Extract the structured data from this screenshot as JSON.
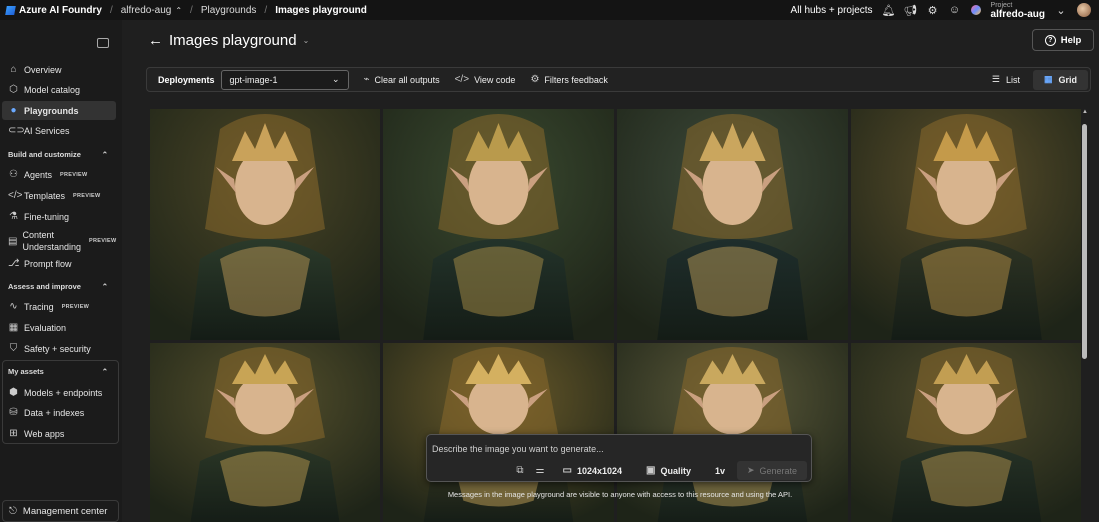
{
  "header": {
    "app_name": "Azure AI Foundry",
    "breadcrumb": [
      "alfredo-aug",
      "Playgrounds",
      "Images playground"
    ],
    "hubs_link": "All hubs + projects",
    "project_label": "Project",
    "project_name": "alfredo-aug"
  },
  "sidebar": {
    "items": [
      {
        "label": "Overview",
        "icon": "home-icon"
      },
      {
        "label": "Model catalog",
        "icon": "cube-icon"
      },
      {
        "label": "Playgrounds",
        "icon": "playground-icon",
        "active": true
      },
      {
        "label": "AI Services",
        "icon": "link-icon"
      }
    ],
    "section_build": "Build and customize",
    "build_items": [
      {
        "label": "Agents",
        "badge": "PREVIEW",
        "icon": "agent-icon"
      },
      {
        "label": "Templates",
        "badge": "PREVIEW",
        "icon": "code-icon"
      },
      {
        "label": "Fine-tuning",
        "icon": "flask-icon"
      },
      {
        "label": "Content Understanding",
        "badge": "PREVIEW",
        "icon": "scan-icon"
      },
      {
        "label": "Prompt flow",
        "icon": "flow-icon"
      }
    ],
    "section_assess": "Assess and improve",
    "assess_items": [
      {
        "label": "Tracing",
        "badge": "PREVIEW",
        "icon": "trace-icon"
      },
      {
        "label": "Evaluation",
        "icon": "evaluation-icon"
      },
      {
        "label": "Safety + security",
        "icon": "shield-icon"
      }
    ],
    "section_assets": "My assets",
    "asset_items": [
      {
        "label": "Models + endpoints",
        "icon": "models-icon"
      },
      {
        "label": "Data + indexes",
        "icon": "database-icon"
      },
      {
        "label": "Web apps",
        "icon": "webapp-icon"
      }
    ],
    "management": "Management center"
  },
  "page": {
    "title": "Images playground",
    "help_label": "Help"
  },
  "toolbar": {
    "deployments_label": "Deployments",
    "deployment_value": "gpt-image-1",
    "clear_label": "Clear all outputs",
    "view_code_label": "View code",
    "filters_label": "Filters feedback",
    "list_label": "List",
    "grid_label": "Grid",
    "active_view": "Grid"
  },
  "gallery": {
    "tile_count": 8
  },
  "prompt": {
    "placeholder": "Describe the image you want to generate...",
    "size": "1024x1024",
    "quality_label": "Quality",
    "count": "1v",
    "generate_label": "Generate"
  },
  "notice": "Messages in the image playground are visible to anyone with access to this resource and using the API.",
  "colors": {
    "accent": "#6aa9ff",
    "background": "#1f1f1f"
  }
}
